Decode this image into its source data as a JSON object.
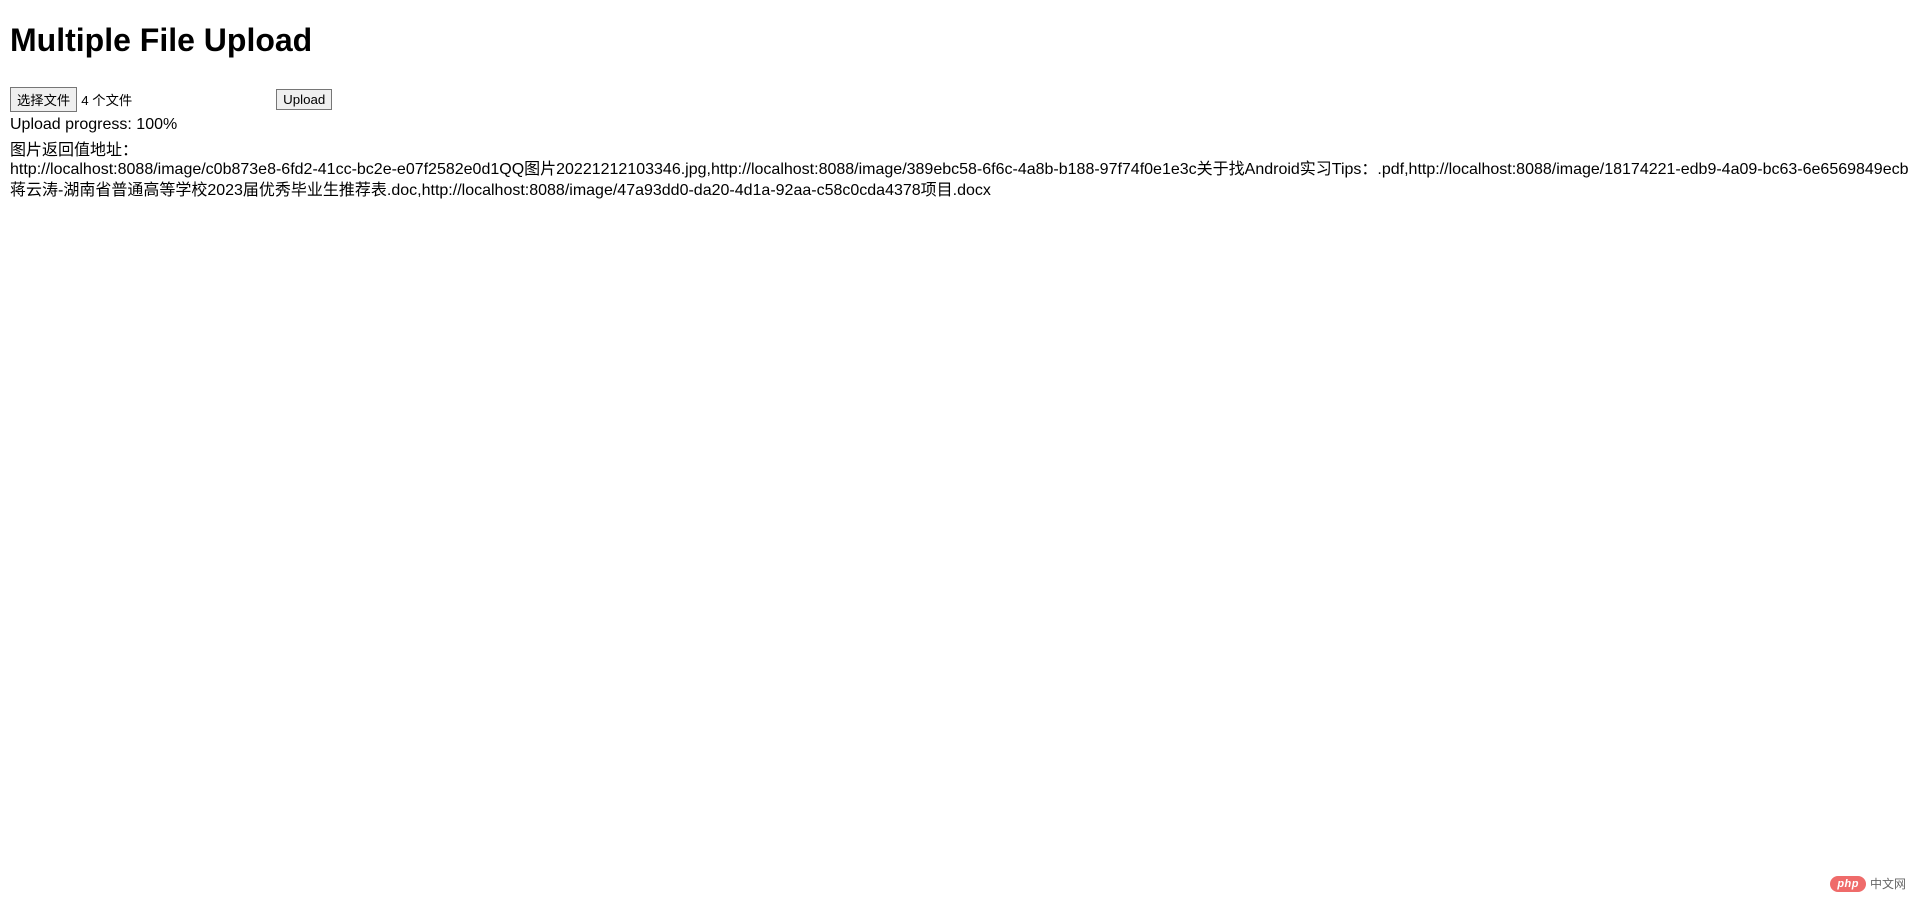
{
  "page": {
    "title": "Multiple File Upload"
  },
  "file_input": {
    "choose_button_label": "选择文件",
    "selected_count_text": "4 个文件"
  },
  "upload": {
    "button_label": "Upload",
    "progress_text": "Upload progress: 100%"
  },
  "result": {
    "label": "图片返回值地址：",
    "urls": "http://localhost:8088/image/c0b873e8-6fd2-41cc-bc2e-e07f2582e0d1QQ图片20221212103346.jpg,http://localhost:8088/image/389ebc58-6f6c-4a8b-b188-97f74f0e1e3c关于找Android实习Tips：.pdf,http://localhost:8088/image/18174221-edb9-4a09-bc63-6e6569849ecb蒋云涛-湖南省普通高等学校2023届优秀毕业生推荐表.doc,http://localhost:8088/image/47a93dd0-da20-4d1a-92aa-c58c0cda4378项目.docx"
  },
  "watermark": {
    "badge": "php",
    "text": "中文网"
  }
}
